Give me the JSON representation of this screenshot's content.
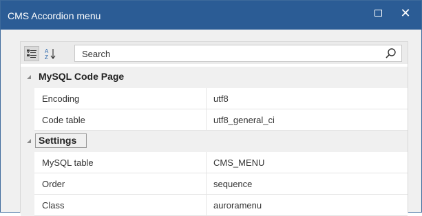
{
  "window": {
    "title": "CMS Accordion menu",
    "maximize_icon": "maximize-icon",
    "close_glyph": "✕"
  },
  "toolbar": {
    "categorized_icon": "categorized-view-icon",
    "alphabetical_icon": "sort-alphabetical-icon",
    "search_placeholder": "Search",
    "search_icon": "search-icon"
  },
  "categories": [
    {
      "name": "MySQL Code Page",
      "properties": [
        {
          "name": "Encoding",
          "value": "utf8"
        },
        {
          "name": "Code table",
          "value": "utf8_general_ci"
        }
      ]
    },
    {
      "name": "Settings",
      "properties": [
        {
          "name": "MySQL table",
          "value": "CMS_MENU"
        },
        {
          "name": "Order",
          "value": "sequence"
        },
        {
          "name": "Class",
          "value": "auroramenu"
        }
      ]
    }
  ],
  "colors": {
    "titlebar": "#2b5c95",
    "background": "#f0f0f0"
  }
}
